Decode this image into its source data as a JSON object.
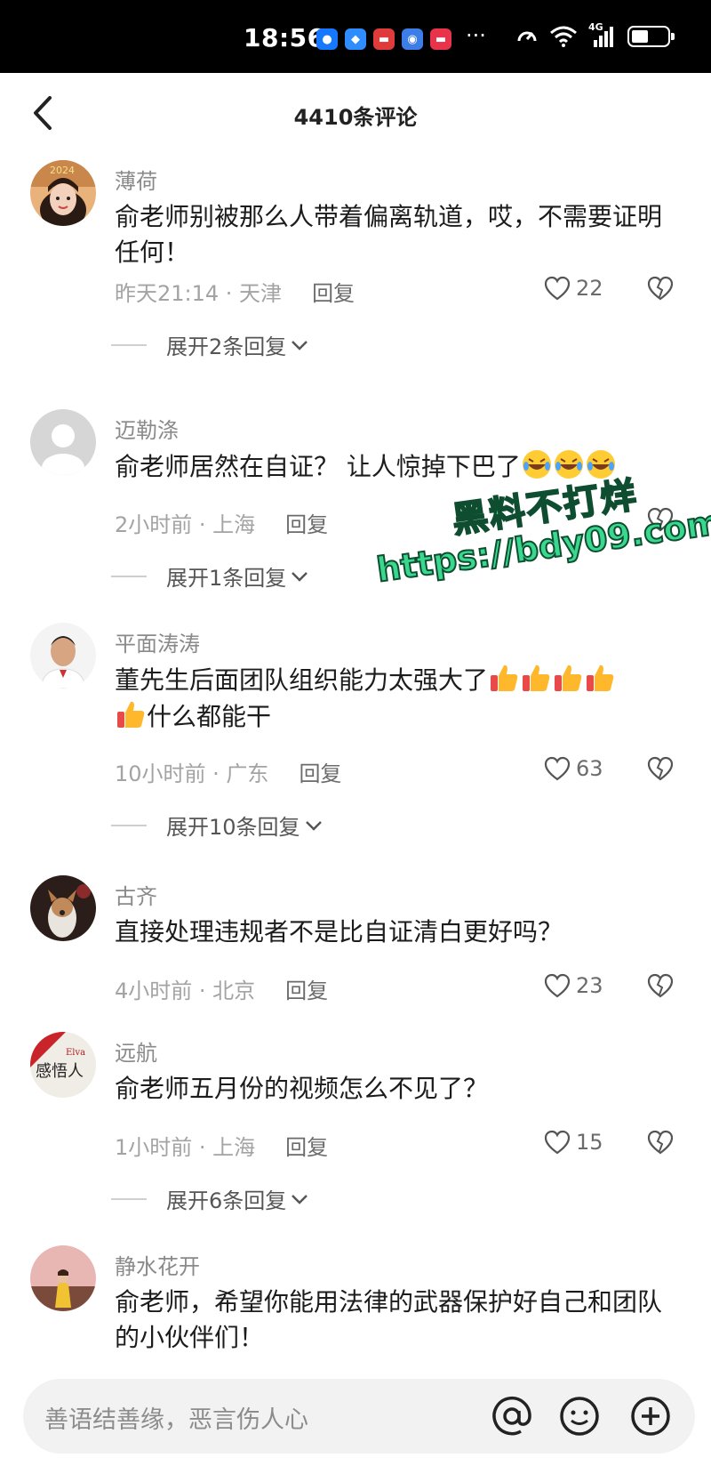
{
  "status_bar": {
    "time": "18:56",
    "network": "4G",
    "more": "···"
  },
  "header": {
    "title": "4410条评论",
    "back_icon": "chevron-left-icon"
  },
  "comments": [
    {
      "user": "薄荷",
      "text": "俞老师别被那么人带着偏离轨道，哎，不需要证明任何！",
      "time": "昨天21:14 · 天津",
      "reply": "回复",
      "likes": "22",
      "expand": "展开2条回复"
    },
    {
      "user": "迈勒涤",
      "text": "俞老师居然在自证？ 让人惊掉下巴了",
      "time": "2小时前 · 上海",
      "reply": "回复",
      "likes": "",
      "expand": "展开1条回复"
    },
    {
      "user": "平面涛涛",
      "text": "董先生后面团队组织能力太强大了",
      "text2": "什么都能干",
      "time": "10小时前 · 广东",
      "reply": "回复",
      "likes": "63",
      "expand": "展开10条回复"
    },
    {
      "user": "古齐",
      "text": "直接处理违规者不是比自证清白更好吗？",
      "time": "4小时前 · 北京",
      "reply": "回复",
      "likes": "23"
    },
    {
      "user": "远航",
      "text": "俞老师五月份的视频怎么不见了？",
      "time": "1小时前 · 上海",
      "reply": "回复",
      "likes": "15",
      "expand": "展开6条回复"
    },
    {
      "user": "静水花开",
      "text": "俞老师，希望你能用法律的武器保护好自己和团队的小伙伴们！"
    }
  ],
  "watermark": {
    "line1": "黑料不打烊",
    "line2": "https://bdy09.com"
  },
  "input": {
    "placeholder": "善语结善缘，恶言伤人心"
  },
  "colors": {
    "accent_watermark": "#3ad88f",
    "text_meta": "#a3a3a3",
    "background": "#ffffff"
  }
}
